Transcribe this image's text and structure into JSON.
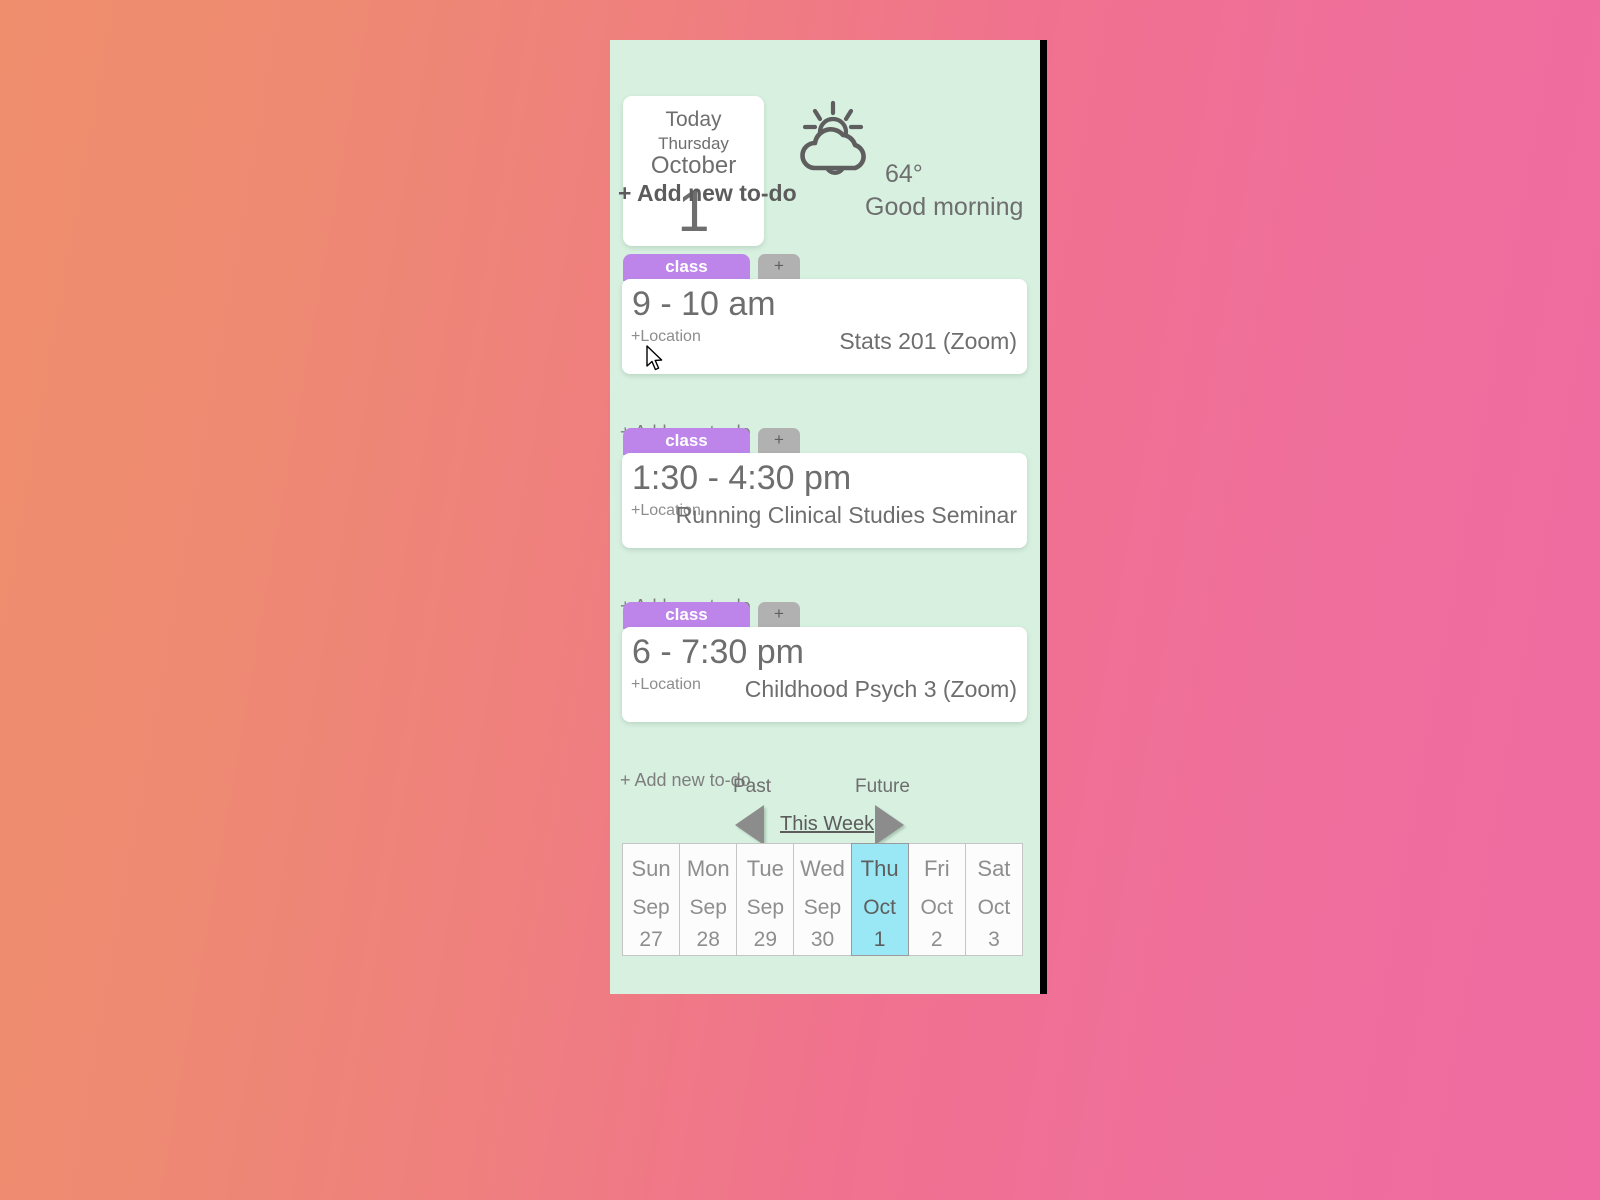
{
  "background": {
    "gradient_from": "#ef8e6d",
    "gradient_to": "#ef6ba2"
  },
  "app": {
    "panel_color": "#d7f0e0",
    "accent_tag_color": "#bd85ea",
    "today_highlight_color": "#9ae8f5"
  },
  "header": {
    "today_card": {
      "today_label": "Today",
      "weekday": "Thursday",
      "month": "October",
      "day_number": "1"
    },
    "weather": {
      "icon": "sun-behind-cloud-icon",
      "temperature": "64°",
      "greeting": "Good morning"
    },
    "add_todo_label": "+ Add new to-do"
  },
  "events": [
    {
      "tag_label": "class",
      "add_tag_label": "+",
      "time": "9 - 10 am",
      "location_placeholder": "+Location",
      "title": "Stats 201 (Zoom)",
      "add_todo_label": "+ Add new to-do"
    },
    {
      "tag_label": "class",
      "add_tag_label": "+",
      "time": "1:30 - 4:30 pm",
      "location_placeholder": "+Location",
      "title": "Running Clinical Studies Seminar",
      "add_todo_label": "+ Add new to-do"
    },
    {
      "tag_label": "class",
      "add_tag_label": "+",
      "time": "6 - 7:30 pm",
      "location_placeholder": "+Location",
      "title": "Childhood Psych 3 (Zoom)",
      "add_todo_label": "+ Add new to-do"
    }
  ],
  "week_nav": {
    "past_label": "Past",
    "future_label": "Future",
    "this_week_label": "This Week",
    "past_arrow_icon": "triangle-left-icon",
    "future_arrow_icon": "triangle-right-icon"
  },
  "week_strip": {
    "days": [
      {
        "dow": "Sun",
        "month": "Sep",
        "num": "27",
        "is_today": false
      },
      {
        "dow": "Mon",
        "month": "Sep",
        "num": "28",
        "is_today": false
      },
      {
        "dow": "Tue",
        "month": "Sep",
        "num": "29",
        "is_today": false
      },
      {
        "dow": "Wed",
        "month": "Sep",
        "num": "30",
        "is_today": false
      },
      {
        "dow": "Thu",
        "month": "Oct",
        "num": "1",
        "is_today": true
      },
      {
        "dow": "Fri",
        "month": "Oct",
        "num": "2",
        "is_today": false
      },
      {
        "dow": "Sat",
        "month": "Oct",
        "num": "3",
        "is_today": false
      }
    ]
  },
  "cursor": {
    "icon": "mouse-pointer-icon"
  }
}
